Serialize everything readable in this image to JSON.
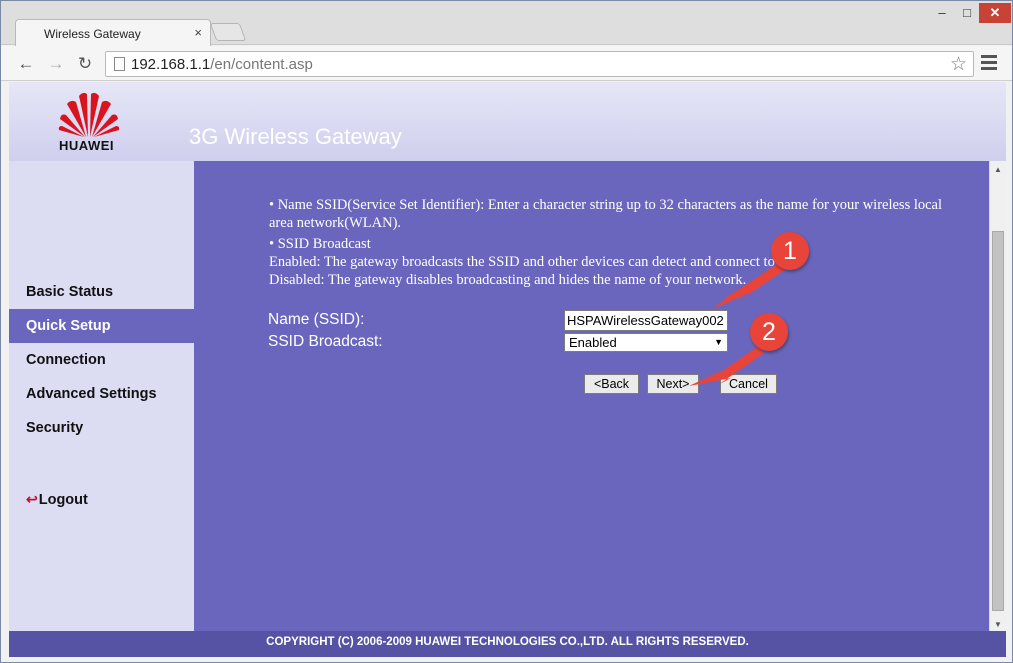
{
  "browser": {
    "tab_title": "Wireless Gateway",
    "tab_close": "×",
    "url_host": "192.168.1.1",
    "url_path": "/en/content.asp",
    "window_min": "–",
    "window_max": "□",
    "window_close": "✕"
  },
  "header": {
    "logo_text": "HUAWEI",
    "product_title": "3G Wireless Gateway"
  },
  "sidebar": {
    "items": [
      {
        "label": "Basic Status"
      },
      {
        "label": "Quick Setup"
      },
      {
        "label": "Connection"
      },
      {
        "label": "Advanced Settings"
      },
      {
        "label": "Security"
      }
    ],
    "logout": "Logout"
  },
  "content": {
    "help_ssid": "•  Name SSID(Service Set Identifier): Enter a character string up to 32 characters as the name for your wireless local area network(WLAN).",
    "help_broadcast_title": "•  SSID Broadcast",
    "help_enabled": "Enabled: The gateway broadcasts the SSID and other devices can detect and connect to it.",
    "help_disabled": "Disabled: The gateway disables broadcasting and hides the name of your network.",
    "ssid_label": "Name (SSID):",
    "ssid_value": "HSPAWirelessGateway002",
    "broadcast_label": "SSID Broadcast:",
    "broadcast_value": "Enabled",
    "back_label": "<Back",
    "next_label": "Next>",
    "cancel_label": "Cancel"
  },
  "callouts": {
    "one": "1",
    "two": "2"
  },
  "footer": {
    "copyright": "COPYRIGHT (C) 2006-2009 HUAWEI TECHNOLOGIES CO.,LTD. ALL RIGHTS RESERVED."
  },
  "colors": {
    "content_bg": "#6a66bd",
    "sidebar_bg": "#dcdcf3",
    "footer_bg": "#5653a5",
    "callout": "#e8443a",
    "logo_red": "#d8141e"
  }
}
